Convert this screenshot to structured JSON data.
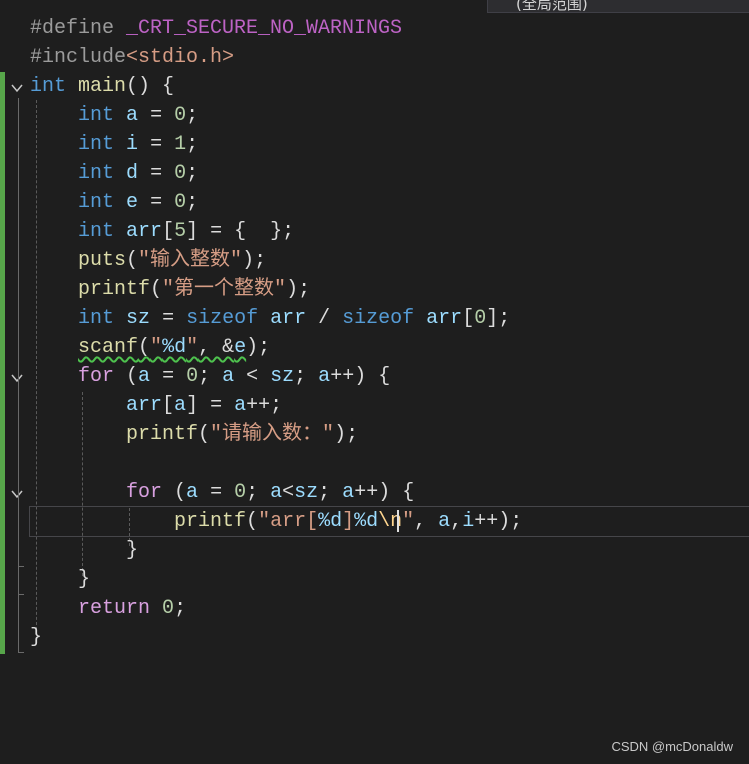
{
  "scope_dropdown": {
    "label": "(全局范围)"
  },
  "code_lines": [
    {
      "id": "l1",
      "tokens": [
        [
          "pp",
          "#define "
        ],
        [
          "mac",
          "_CRT_SECURE_NO_WARNINGS"
        ]
      ]
    },
    {
      "id": "l2",
      "tokens": [
        [
          "pp",
          "#include"
        ],
        [
          "str",
          "<stdio.h>"
        ]
      ]
    },
    {
      "id": "l3",
      "tokens": [
        [
          "kw",
          "int"
        ],
        [
          "plain",
          " "
        ],
        [
          "fn",
          "main"
        ],
        [
          "plain",
          "() {"
        ]
      ]
    },
    {
      "id": "l4",
      "tokens": [
        [
          "plain",
          "    "
        ],
        [
          "kw",
          "int"
        ],
        [
          "plain",
          " "
        ],
        [
          "var",
          "a"
        ],
        [
          "plain",
          " = "
        ],
        [
          "num",
          "0"
        ],
        [
          "plain",
          ";"
        ]
      ]
    },
    {
      "id": "l5",
      "tokens": [
        [
          "plain",
          "    "
        ],
        [
          "kw",
          "int"
        ],
        [
          "plain",
          " "
        ],
        [
          "var",
          "i"
        ],
        [
          "plain",
          " = "
        ],
        [
          "num",
          "1"
        ],
        [
          "plain",
          ";"
        ]
      ]
    },
    {
      "id": "l6",
      "tokens": [
        [
          "plain",
          "    "
        ],
        [
          "kw",
          "int"
        ],
        [
          "plain",
          " "
        ],
        [
          "var",
          "d"
        ],
        [
          "plain",
          " = "
        ],
        [
          "num",
          "0"
        ],
        [
          "plain",
          ";"
        ]
      ]
    },
    {
      "id": "l7",
      "tokens": [
        [
          "plain",
          "    "
        ],
        [
          "kw",
          "int"
        ],
        [
          "plain",
          " "
        ],
        [
          "var",
          "e"
        ],
        [
          "plain",
          " = "
        ],
        [
          "num",
          "0"
        ],
        [
          "plain",
          ";"
        ]
      ]
    },
    {
      "id": "l8",
      "tokens": [
        [
          "plain",
          "    "
        ],
        [
          "kw",
          "int"
        ],
        [
          "plain",
          " "
        ],
        [
          "var",
          "arr"
        ],
        [
          "plain",
          "["
        ],
        [
          "num",
          "5"
        ],
        [
          "plain",
          "] = {  };"
        ]
      ]
    },
    {
      "id": "l9",
      "tokens": [
        [
          "plain",
          "    "
        ],
        [
          "fn",
          "puts"
        ],
        [
          "plain",
          "("
        ],
        [
          "str",
          "\"输入整数\""
        ],
        [
          "plain",
          ");"
        ]
      ]
    },
    {
      "id": "l10",
      "tokens": [
        [
          "plain",
          "    "
        ],
        [
          "fn",
          "printf"
        ],
        [
          "plain",
          "("
        ],
        [
          "str",
          "\"第一个整数\""
        ],
        [
          "plain",
          ");"
        ]
      ]
    },
    {
      "id": "l11",
      "tokens": [
        [
          "plain",
          "    "
        ],
        [
          "kw",
          "int"
        ],
        [
          "plain",
          " "
        ],
        [
          "var",
          "sz"
        ],
        [
          "plain",
          " = "
        ],
        [
          "kw",
          "sizeof"
        ],
        [
          "plain",
          " "
        ],
        [
          "var",
          "arr"
        ],
        [
          "plain",
          " / "
        ],
        [
          "kw",
          "sizeof"
        ],
        [
          "plain",
          " "
        ],
        [
          "var",
          "arr"
        ],
        [
          "plain",
          "["
        ],
        [
          "num",
          "0"
        ],
        [
          "plain",
          "];"
        ]
      ]
    },
    {
      "id": "l12",
      "tokens": [
        [
          "plain",
          "    "
        ],
        [
          "fn squig",
          "scanf"
        ],
        [
          "plain squig",
          "("
        ],
        [
          "str squig",
          "\""
        ],
        [
          "fmt squig",
          "%d"
        ],
        [
          "str squig",
          "\""
        ],
        [
          "plain squig",
          ", &"
        ],
        [
          "var squig",
          "e"
        ],
        [
          "plain",
          ");"
        ]
      ]
    },
    {
      "id": "l13",
      "tokens": [
        [
          "plain",
          "    "
        ],
        [
          "ctl",
          "for"
        ],
        [
          "plain",
          " ("
        ],
        [
          "var",
          "a"
        ],
        [
          "plain",
          " = "
        ],
        [
          "num",
          "0"
        ],
        [
          "plain",
          "; "
        ],
        [
          "var",
          "a"
        ],
        [
          "plain",
          " < "
        ],
        [
          "var",
          "sz"
        ],
        [
          "plain",
          "; "
        ],
        [
          "var",
          "a"
        ],
        [
          "plain",
          "++) {"
        ]
      ]
    },
    {
      "id": "l14",
      "tokens": [
        [
          "plain",
          "        "
        ],
        [
          "var",
          "arr"
        ],
        [
          "plain",
          "["
        ],
        [
          "var",
          "a"
        ],
        [
          "plain",
          "] = "
        ],
        [
          "var",
          "a"
        ],
        [
          "plain",
          "++;"
        ]
      ]
    },
    {
      "id": "l15",
      "tokens": [
        [
          "plain",
          "        "
        ],
        [
          "fn",
          "printf"
        ],
        [
          "plain",
          "("
        ],
        [
          "str",
          "\"请输入数：\""
        ],
        [
          "plain",
          ");"
        ]
      ]
    },
    {
      "id": "l16",
      "tokens": [
        [
          "plain",
          ""
        ]
      ]
    },
    {
      "id": "l17",
      "tokens": [
        [
          "plain",
          "        "
        ],
        [
          "ctl",
          "for"
        ],
        [
          "plain",
          " ("
        ],
        [
          "var",
          "a"
        ],
        [
          "plain",
          " = "
        ],
        [
          "num",
          "0"
        ],
        [
          "plain",
          "; "
        ],
        [
          "var",
          "a"
        ],
        [
          "plain",
          "<"
        ],
        [
          "var",
          "sz"
        ],
        [
          "plain",
          "; "
        ],
        [
          "var",
          "a"
        ],
        [
          "plain",
          "++) {"
        ]
      ]
    },
    {
      "id": "l18",
      "tokens": [
        [
          "plain",
          "            "
        ],
        [
          "fn",
          "printf"
        ],
        [
          "plain",
          "("
        ],
        [
          "str",
          "\"arr["
        ],
        [
          "fmt",
          "%d"
        ],
        [
          "str",
          "]"
        ],
        [
          "fmt",
          "%d"
        ],
        [
          "esc",
          "\\n"
        ],
        [
          "str",
          "\""
        ],
        [
          "plain",
          ", "
        ],
        [
          "var",
          "a"
        ],
        [
          "plain",
          ","
        ],
        [
          "var",
          "i"
        ],
        [
          "plain",
          "++);"
        ]
      ]
    },
    {
      "id": "l19",
      "tokens": [
        [
          "plain",
          "        }"
        ]
      ]
    },
    {
      "id": "l20",
      "tokens": [
        [
          "plain",
          "    }"
        ]
      ]
    },
    {
      "id": "l21",
      "tokens": [
        [
          "plain",
          "    "
        ],
        [
          "ctl",
          "return"
        ],
        [
          "plain",
          " "
        ],
        [
          "num",
          "0"
        ],
        [
          "plain",
          ";"
        ]
      ]
    },
    {
      "id": "l22",
      "tokens": [
        [
          "plain",
          "}"
        ]
      ]
    }
  ],
  "watermark": "CSDN @mcDonaldw",
  "colors": {
    "background": "#1e1e1e",
    "change_bar": "#57a64a",
    "keyword": "#569cd6",
    "control": "#d8a0df",
    "function": "#dcdcaa",
    "string": "#d69d85",
    "number": "#b5cea8",
    "variable": "#9cdcfe"
  }
}
